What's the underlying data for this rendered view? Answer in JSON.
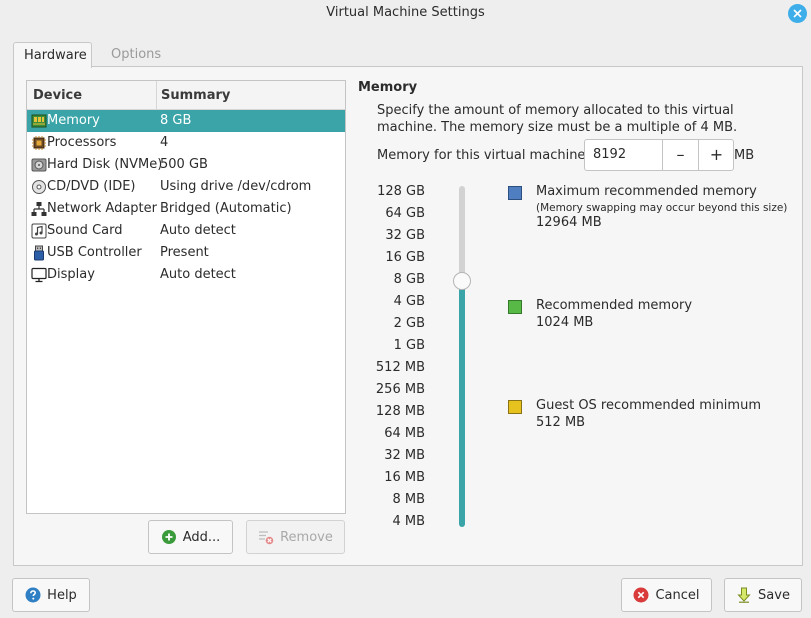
{
  "window": {
    "title": "Virtual Machine Settings"
  },
  "tabs": [
    {
      "label": "Hardware",
      "active": true
    },
    {
      "label": "Options",
      "active": false
    }
  ],
  "device_list": {
    "headers": {
      "device": "Device",
      "summary": "Summary"
    },
    "items": [
      {
        "device": "Memory",
        "summary": "8 GB",
        "icon": "memory-icon",
        "selected": true
      },
      {
        "device": "Processors",
        "summary": "4",
        "icon": "processor-icon"
      },
      {
        "device": "Hard Disk (NVMe)",
        "summary": "500 GB",
        "icon": "hard-disk-icon"
      },
      {
        "device": "CD/DVD (IDE)",
        "summary": "Using drive /dev/cdrom",
        "icon": "cd-dvd-icon"
      },
      {
        "device": "Network Adapter",
        "summary": "Bridged (Automatic)",
        "icon": "network-icon"
      },
      {
        "device": "Sound Card",
        "summary": "Auto detect",
        "icon": "sound-card-icon"
      },
      {
        "device": "USB Controller",
        "summary": "Present",
        "icon": "usb-icon"
      },
      {
        "device": "Display",
        "summary": "Auto detect",
        "icon": "display-icon"
      }
    ]
  },
  "buttons": {
    "add": "Add...",
    "remove": "Remove",
    "help": "Help",
    "cancel": "Cancel",
    "save": "Save"
  },
  "memory": {
    "title": "Memory",
    "description": "Specify the amount of memory allocated to this virtual machine. The memory size must be a multiple of 4 MB.",
    "field_label": "Memory for this virtual machine:",
    "value": "8192",
    "unit": "MB",
    "scale": [
      "128 GB",
      "64 GB",
      "32 GB",
      "16 GB",
      "8 GB",
      "4 GB",
      "2 GB",
      "1 GB",
      "512 MB",
      "256 MB",
      "128 MB",
      "64 MB",
      "32 MB",
      "16 MB",
      "8 MB",
      "4 MB"
    ],
    "slider_selected": "8 GB",
    "legend": [
      {
        "label": "Maximum recommended memory",
        "note": "(Memory swapping may occur beyond this size)",
        "value": "12964 MB",
        "color": "#4f7fc0"
      },
      {
        "label": "Recommended memory",
        "value": "1024 MB",
        "color": "#58b947"
      },
      {
        "label": "Guest OS recommended minimum",
        "value": "512 MB",
        "color": "#e6c21f"
      }
    ]
  },
  "colors": {
    "accent": "#3aa4a8",
    "selection_text": "#ffffff"
  }
}
